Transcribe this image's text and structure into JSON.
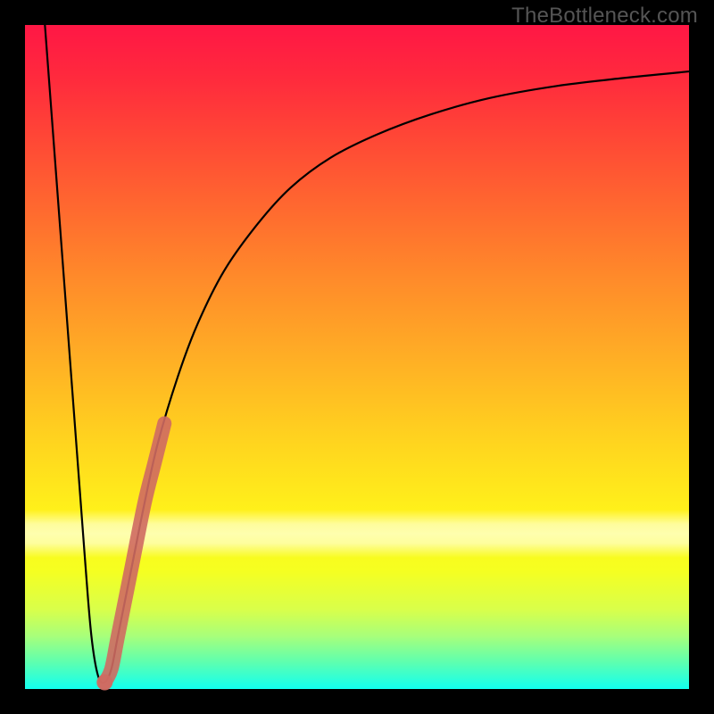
{
  "watermark": "TheBottleneck.com",
  "chart_data": {
    "type": "line",
    "title": "",
    "xlabel": "",
    "ylabel": "",
    "xlim": [
      0,
      100
    ],
    "ylim": [
      0,
      100
    ],
    "series": [
      {
        "name": "curve",
        "x": [
          3,
          6,
          9,
          10,
          11,
          12,
          13,
          14,
          16,
          18,
          20,
          23,
          26,
          30,
          35,
          40,
          46,
          53,
          61,
          70,
          80,
          90,
          100
        ],
        "values": [
          100,
          60,
          20,
          8,
          2,
          1,
          3,
          8,
          18,
          28,
          37,
          47,
          55,
          63,
          70,
          75.5,
          80,
          83.5,
          86.5,
          89,
          90.8,
          92,
          93
        ]
      }
    ],
    "overlay_segment": {
      "name": "highlight-band",
      "color": "#cf6a62",
      "x": [
        12,
        13,
        14,
        16,
        18,
        19.5,
        21
      ],
      "values": [
        1,
        3,
        8,
        18,
        28,
        34,
        40
      ]
    },
    "gradient_stops": [
      {
        "pos": 0.0,
        "color": "#ff1745"
      },
      {
        "pos": 0.08,
        "color": "#ff2a3d"
      },
      {
        "pos": 0.18,
        "color": "#ff4a35"
      },
      {
        "pos": 0.28,
        "color": "#ff6a2f"
      },
      {
        "pos": 0.38,
        "color": "#ff8a2a"
      },
      {
        "pos": 0.5,
        "color": "#ffae25"
      },
      {
        "pos": 0.62,
        "color": "#ffd21f"
      },
      {
        "pos": 0.74,
        "color": "#fff31a"
      },
      {
        "pos": 0.82,
        "color": "#f6ff20"
      },
      {
        "pos": 0.88,
        "color": "#d9ff4a"
      },
      {
        "pos": 0.92,
        "color": "#a8ff7a"
      },
      {
        "pos": 0.96,
        "color": "#5dffb0"
      },
      {
        "pos": 1.0,
        "color": "#12fff0"
      }
    ]
  }
}
